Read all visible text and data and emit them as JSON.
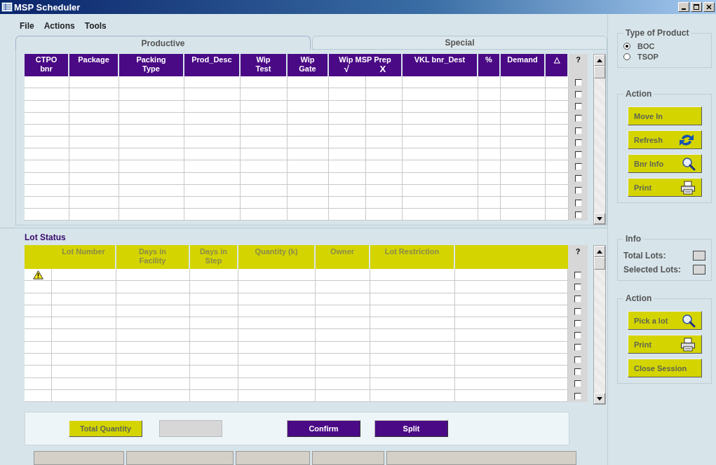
{
  "window": {
    "title": "MSP Scheduler"
  },
  "menu": [
    "File",
    "Actions",
    "Tools"
  ],
  "tabs": [
    {
      "label": "Productive",
      "selected": true
    },
    {
      "label": "Special",
      "selected": false
    }
  ],
  "wip_table": {
    "columns": [
      {
        "kind": "text",
        "label": "CTPO bnr"
      },
      {
        "kind": "text",
        "label": "Package"
      },
      {
        "kind": "text",
        "label": "Packing Type"
      },
      {
        "kind": "text",
        "label": "Prod_Desc"
      },
      {
        "kind": "text",
        "label": "Wip Test"
      },
      {
        "kind": "text",
        "label": "Wip Gate"
      },
      {
        "kind": "split",
        "label": "Wip MSP Prep",
        "sub": [
          "√",
          "X"
        ]
      },
      {
        "kind": "text",
        "label": "VKL bnr_Dest"
      },
      {
        "kind": "text",
        "label": "%"
      },
      {
        "kind": "text",
        "label": "Demand"
      },
      {
        "kind": "text",
        "label": "△"
      },
      {
        "kind": "check",
        "label": "?"
      }
    ],
    "rows": [
      {
        "checked": false
      },
      {
        "checked": false
      },
      {
        "checked": false
      },
      {
        "checked": false
      },
      {
        "checked": false
      },
      {
        "checked": false
      },
      {
        "checked": false
      },
      {
        "checked": false
      },
      {
        "checked": false
      },
      {
        "checked": false
      },
      {
        "checked": false
      },
      {
        "checked": false
      }
    ]
  },
  "lot_status": {
    "title": "Lot Status",
    "columns": [
      {
        "kind": "icon"
      },
      {
        "kind": "text",
        "label": "Lot Number"
      },
      {
        "kind": "text",
        "label": "Days in Facility"
      },
      {
        "kind": "text",
        "label": "Days in Step"
      },
      {
        "kind": "text",
        "label": "Quantity (k)"
      },
      {
        "kind": "text",
        "label": "Owner"
      },
      {
        "kind": "text",
        "label": "Lot Restriction"
      },
      {
        "kind": "blank"
      },
      {
        "kind": "check",
        "label": "?"
      }
    ],
    "rows": [
      {
        "warning": true,
        "checked": false
      },
      {
        "warning": false,
        "checked": false
      },
      {
        "warning": false,
        "checked": false
      },
      {
        "warning": false,
        "checked": false
      },
      {
        "warning": false,
        "checked": false
      },
      {
        "warning": false,
        "checked": false
      },
      {
        "warning": false,
        "checked": false
      },
      {
        "warning": false,
        "checked": false
      },
      {
        "warning": false,
        "checked": false
      },
      {
        "warning": false,
        "checked": false
      },
      {
        "warning": false,
        "checked": false
      }
    ]
  },
  "bottom_bar": {
    "total_button": "Total Quantity",
    "buttons": [
      "Confirm",
      "Split"
    ]
  },
  "type_of_product": {
    "title": "Type of Product",
    "options": [
      {
        "label": "BOC",
        "selected": true
      },
      {
        "label": "TSOP",
        "selected": false
      }
    ]
  },
  "action_top": {
    "title": "Action",
    "buttons": [
      "Move In",
      "Refresh",
      "Bnr Info",
      "Print"
    ]
  },
  "info": {
    "title": "Info",
    "fields": [
      "Total Lots:",
      "Selected Lots:"
    ]
  },
  "action_bottom": {
    "title": "Action",
    "buttons": [
      "Pick a lot",
      "Print",
      "Close Session"
    ]
  }
}
